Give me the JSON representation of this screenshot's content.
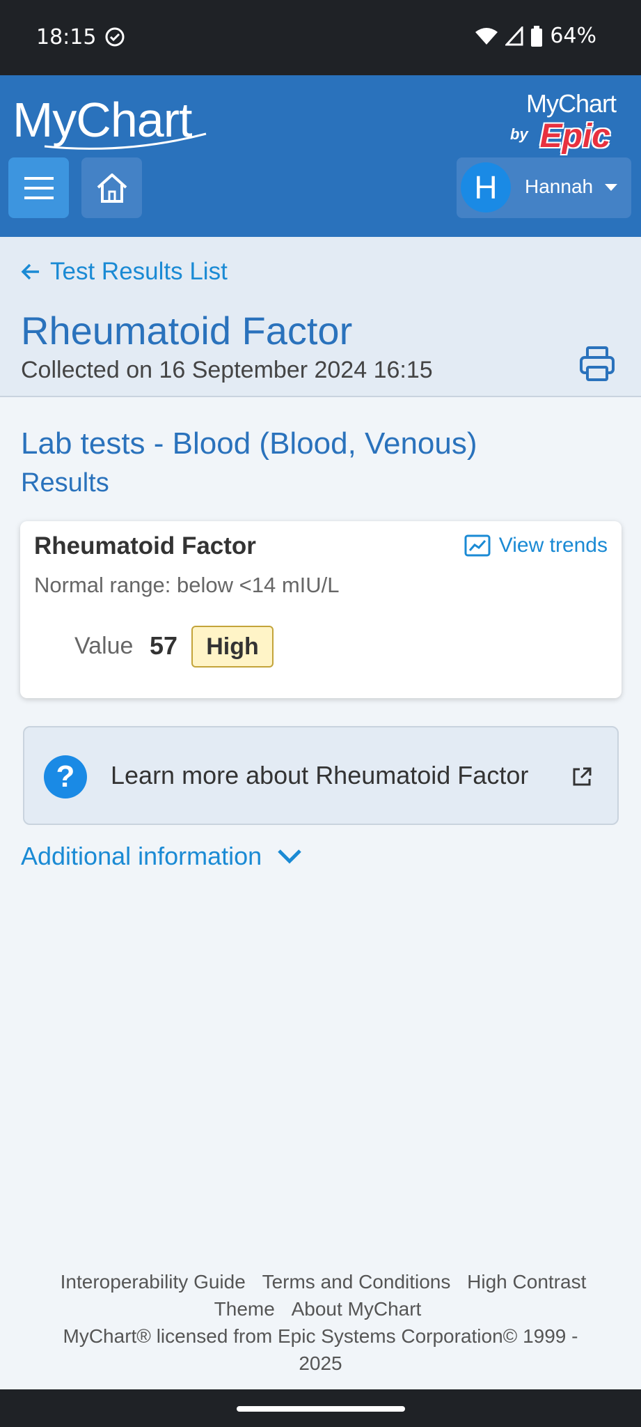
{
  "status_bar": {
    "time": "18:15",
    "battery": "64%"
  },
  "header": {
    "logo": "MyChart",
    "badge_top": "MyChart",
    "badge_by": "by",
    "badge_brand": "Epic",
    "user_initial": "H",
    "user_name": "Hannah"
  },
  "title_band": {
    "back_link": "Test Results List",
    "title": "Rheumatoid Factor",
    "collected": "Collected on 16 September 2024 16:15"
  },
  "section": {
    "title": "Lab tests - Blood (Blood, Venous)",
    "subtitle": "Results"
  },
  "result": {
    "name": "Rheumatoid Factor",
    "view_trends": "View trends",
    "normal_range": "Normal range: below <14 mIU/L",
    "value_label": "Value",
    "value": "57",
    "flag": "High"
  },
  "learn_more": {
    "text": "Learn more about Rheumatoid Factor",
    "icon": "?"
  },
  "additional": {
    "label": "Additional information"
  },
  "footer": {
    "links": [
      "Interoperability Guide",
      "Terms and Conditions",
      "High Contrast Theme",
      "About MyChart"
    ],
    "copyright_1": "MyChart® licensed from Epic Systems Corporation© 1999 -",
    "copyright_2": "2025"
  },
  "colors": {
    "header": "#2a72bc",
    "link": "#1a8ad4",
    "flag_bg": "#fff4c7",
    "background": "#f1f5f9"
  }
}
